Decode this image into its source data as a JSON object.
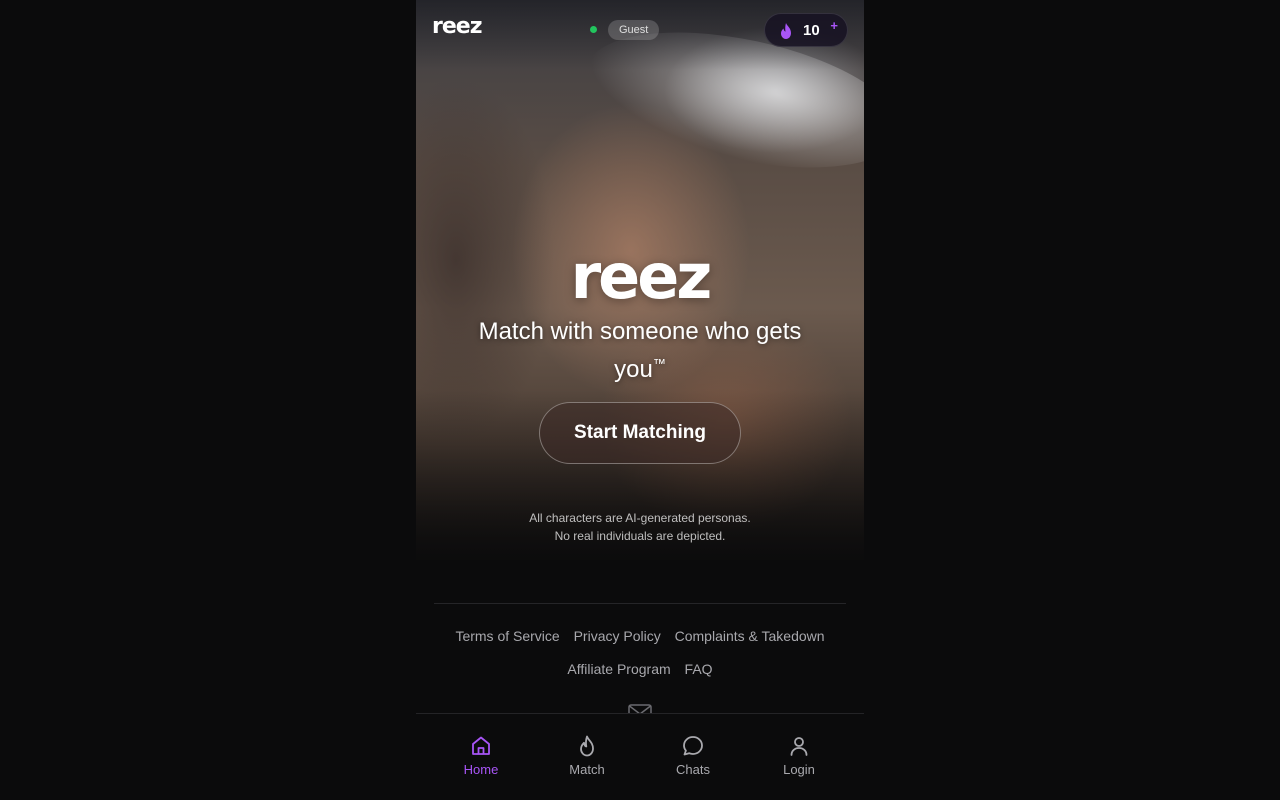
{
  "header": {
    "logo": "reez",
    "status": "Guest",
    "credits": "10",
    "credits_plus": "+"
  },
  "hero": {
    "logo": "reez",
    "tagline": "Match with someone who gets you",
    "tagline_tm": "™",
    "cta": "Start Matching",
    "disclaimer_line1": "All characters are AI-generated personas.",
    "disclaimer_line2": "No real individuals are depicted."
  },
  "footer": {
    "links_row1": [
      "Terms of Service",
      "Privacy Policy",
      "Complaints & Takedown"
    ],
    "links_row2": [
      "Affiliate Program",
      "FAQ"
    ]
  },
  "nav": {
    "items": [
      {
        "label": "Home",
        "icon": "home-icon",
        "active": true
      },
      {
        "label": "Match",
        "icon": "flame-icon",
        "active": false
      },
      {
        "label": "Chats",
        "icon": "chat-bubble-icon",
        "active": false
      },
      {
        "label": "Login",
        "icon": "user-icon",
        "active": false
      }
    ]
  },
  "colors": {
    "accent": "#a855f7",
    "background": "#0b0b0c",
    "online": "#22c55e"
  }
}
